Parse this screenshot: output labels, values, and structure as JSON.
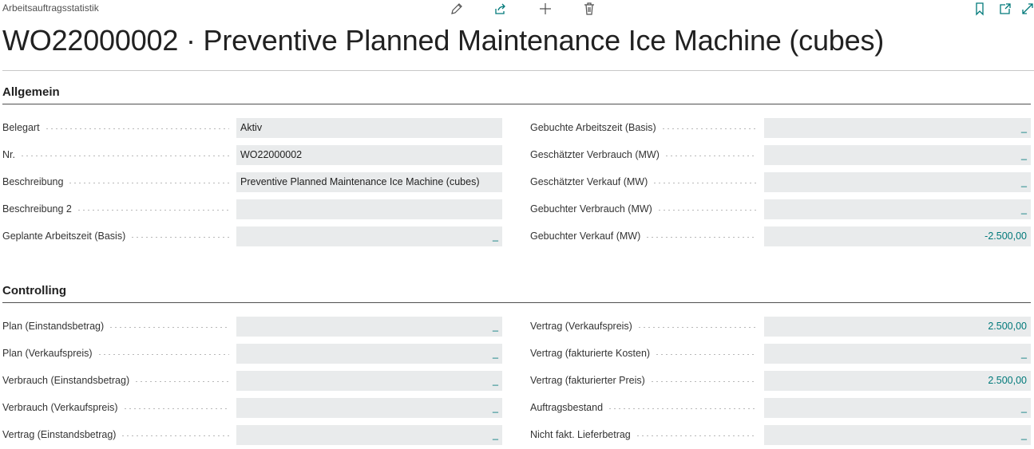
{
  "header": {
    "breadcrumb": "Arbeitsauftragsstatistik",
    "title": "WO22000002 · Preventive Planned Maintenance Ice Machine (cubes)"
  },
  "toolbar": {
    "icons": [
      "edit-icon",
      "share-icon",
      "add-icon",
      "delete-icon",
      "bookmark-icon",
      "open-new-window-icon",
      "expand-icon"
    ]
  },
  "sections": {
    "general": {
      "title": "Allgemein",
      "left": [
        {
          "label": "Belegart",
          "value": "Aktiv"
        },
        {
          "label": "Nr.",
          "value": "WO22000002"
        },
        {
          "label": "Beschreibung",
          "value": "Preventive Planned Maintenance Ice Machine (cubes)"
        },
        {
          "label": "Beschreibung 2",
          "value": ""
        },
        {
          "label": "Geplante Arbeitszeit (Basis)",
          "value": "_"
        }
      ],
      "right": [
        {
          "label": "Gebuchte Arbeitszeit (Basis)",
          "value": "_"
        },
        {
          "label": "Geschätzter Verbrauch (MW)",
          "value": "_"
        },
        {
          "label": "Geschätzter Verkauf (MW)",
          "value": "_"
        },
        {
          "label": "Gebuchter Verbrauch (MW)",
          "value": "_"
        },
        {
          "label": "Gebuchter Verkauf (MW)",
          "value": "-2.500,00"
        }
      ]
    },
    "controlling": {
      "title": "Controlling",
      "left": [
        {
          "label": "Plan (Einstandsbetrag)",
          "value": "_"
        },
        {
          "label": "Plan (Verkaufspreis)",
          "value": "_"
        },
        {
          "label": "Verbrauch (Einstandsbetrag)",
          "value": "_"
        },
        {
          "label": "Verbrauch (Verkaufspreis)",
          "value": "_"
        },
        {
          "label": "Vertrag (Einstandsbetrag)",
          "value": "_"
        }
      ],
      "right": [
        {
          "label": "Vertrag (Verkaufspreis)",
          "value": "2.500,00"
        },
        {
          "label": "Vertrag (fakturierte Kosten)",
          "value": "_"
        },
        {
          "label": "Vertrag (fakturierter Preis)",
          "value": "2.500,00"
        },
        {
          "label": "Auftragsbestand",
          "value": "_"
        },
        {
          "label": "Nicht fakt. Lieferbetrag",
          "value": "_"
        }
      ]
    }
  }
}
